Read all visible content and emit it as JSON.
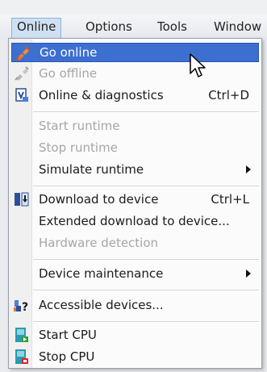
{
  "menubar": {
    "items": [
      {
        "label": "Online",
        "active": true
      },
      {
        "label": "Options"
      },
      {
        "label": "Tools"
      },
      {
        "label": "Window"
      }
    ]
  },
  "menu": {
    "go_online": {
      "label": "Go online",
      "icon": "go-online-icon"
    },
    "go_offline": {
      "label": "Go offline",
      "icon": "go-offline-icon"
    },
    "online_diagnostics": {
      "label": "Online & diagnostics",
      "shortcut": "Ctrl+D",
      "icon": "diagnostics-icon"
    },
    "start_runtime": {
      "label": "Start runtime"
    },
    "stop_runtime": {
      "label": "Stop runtime"
    },
    "simulate_runtime": {
      "label": "Simulate runtime"
    },
    "download_to_device": {
      "label": "Download to device",
      "shortcut": "Ctrl+L",
      "icon": "download-icon"
    },
    "extended_download": {
      "label": "Extended download to device..."
    },
    "hardware_detection": {
      "label": "Hardware detection"
    },
    "device_maintenance": {
      "label": "Device maintenance"
    },
    "accessible_devices": {
      "label": "Accessible devices...",
      "icon": "accessible-devices-icon"
    },
    "start_cpu": {
      "label": "Start CPU",
      "icon": "start-cpu-icon"
    },
    "stop_cpu": {
      "label": "Stop CPU",
      "icon": "stop-cpu-icon"
    }
  },
  "colors": {
    "highlight": "#3c6fd0",
    "disabled_text": "#a6a6a6",
    "text": "#1b1b1b"
  }
}
